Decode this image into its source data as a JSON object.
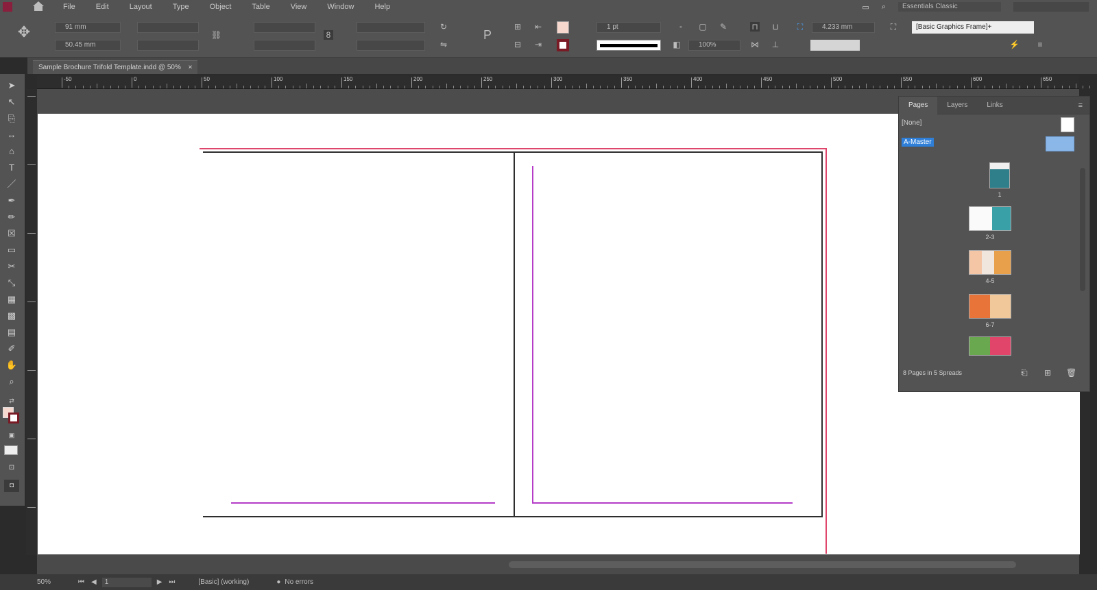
{
  "menu": {
    "items": [
      "File",
      "Edit",
      "Layout",
      "Type",
      "Object",
      "Table",
      "View",
      "Window",
      "Help"
    ],
    "workspace": "Essentials Classic"
  },
  "control_bar": {
    "x_value": "91 mm",
    "y_value": "50.45 mm",
    "stroke_weight": "1 pt",
    "opacity": "100%",
    "effect_value": "4.233 mm",
    "style_name": "[Basic Graphics Frame]+"
  },
  "tab": {
    "title": "Sample Brochure Trifold Template.indd @ 50%",
    "close_glyph": "×"
  },
  "ruler": {
    "labels": [
      "-50",
      "0",
      "50",
      "100",
      "150",
      "200",
      "250",
      "300",
      "350",
      "400",
      "450",
      "500",
      "550",
      "600",
      "650"
    ]
  },
  "pages_panel": {
    "tabs": [
      "Pages",
      "Layers",
      "Links"
    ],
    "none_label": "[None]",
    "master_label": "A-Master",
    "page_labels": [
      "1",
      "2-3",
      "4-5",
      "6-7",
      ""
    ],
    "footer": "8 Pages in 5 Spreads"
  },
  "status": {
    "zoom": "50%",
    "page": "1",
    "mode": "[Basic] (working)",
    "errors": "No errors"
  },
  "colors": {
    "fill_swatch": "#f6d8cf",
    "stroke_swatch": "#7a1a25",
    "bleed": "#e0466b",
    "margin": "#b43cc7",
    "selected": "#2f7fd8"
  }
}
